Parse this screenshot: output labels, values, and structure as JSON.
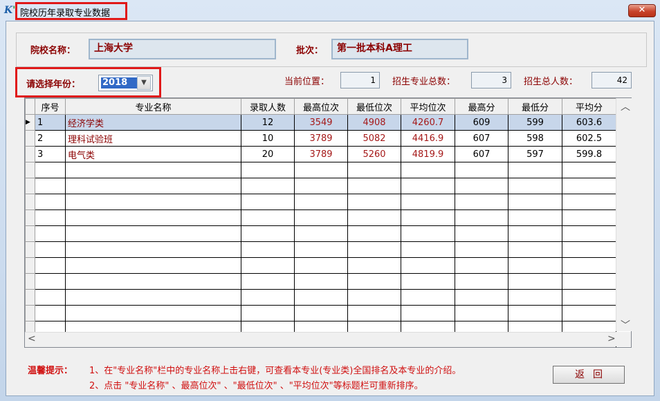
{
  "window": {
    "title": "院校历年录取专业数据",
    "close_label": "✕"
  },
  "school": {
    "label": "院校名称：",
    "value": "上海大学"
  },
  "batch": {
    "label": "批次：",
    "value": "第一批本科A理工"
  },
  "year": {
    "label": "请选择年份：",
    "value": "2018"
  },
  "stats": {
    "position_label": "当前位置：",
    "position_value": "1",
    "majors_label": "招生专业总数：",
    "majors_value": "3",
    "students_label": "招生总人数：",
    "students_value": "42"
  },
  "grid": {
    "columns": [
      "序号",
      "专业名称",
      "录取人数",
      "最高位次",
      "最低位次",
      "平均位次",
      "最高分",
      "最低分",
      "平均分"
    ],
    "rows": [
      {
        "no": "1",
        "name": "经济学类",
        "count": "12",
        "top_rank": "3549",
        "low_rank": "4908",
        "avg_rank": "4260.7",
        "max": "609",
        "min": "599",
        "avg": "603.6"
      },
      {
        "no": "2",
        "name": "理科试验班",
        "count": "10",
        "top_rank": "3789",
        "low_rank": "5082",
        "avg_rank": "4416.9",
        "max": "607",
        "min": "598",
        "avg": "602.5"
      },
      {
        "no": "3",
        "name": "电气类",
        "count": "20",
        "top_rank": "3789",
        "low_rank": "5260",
        "avg_rank": "4819.9",
        "max": "607",
        "min": "597",
        "avg": "599.8"
      }
    ]
  },
  "tips": {
    "label": "温馨提示：",
    "line1": "1、在\"专业名称\"栏中的专业名称上击右键，可查看本专业(专业类)全国排名及本专业的介绍。",
    "line2": "2、点击 \"专业名称\" 、最高位次\" 、\"最低位次\" 、\"平均位次\"等标题栏可重新排序。"
  },
  "back_button": "返回",
  "colors": {
    "accent_red": "#8b0000",
    "highlight": "#e01818",
    "selection": "#c7d6ea"
  }
}
